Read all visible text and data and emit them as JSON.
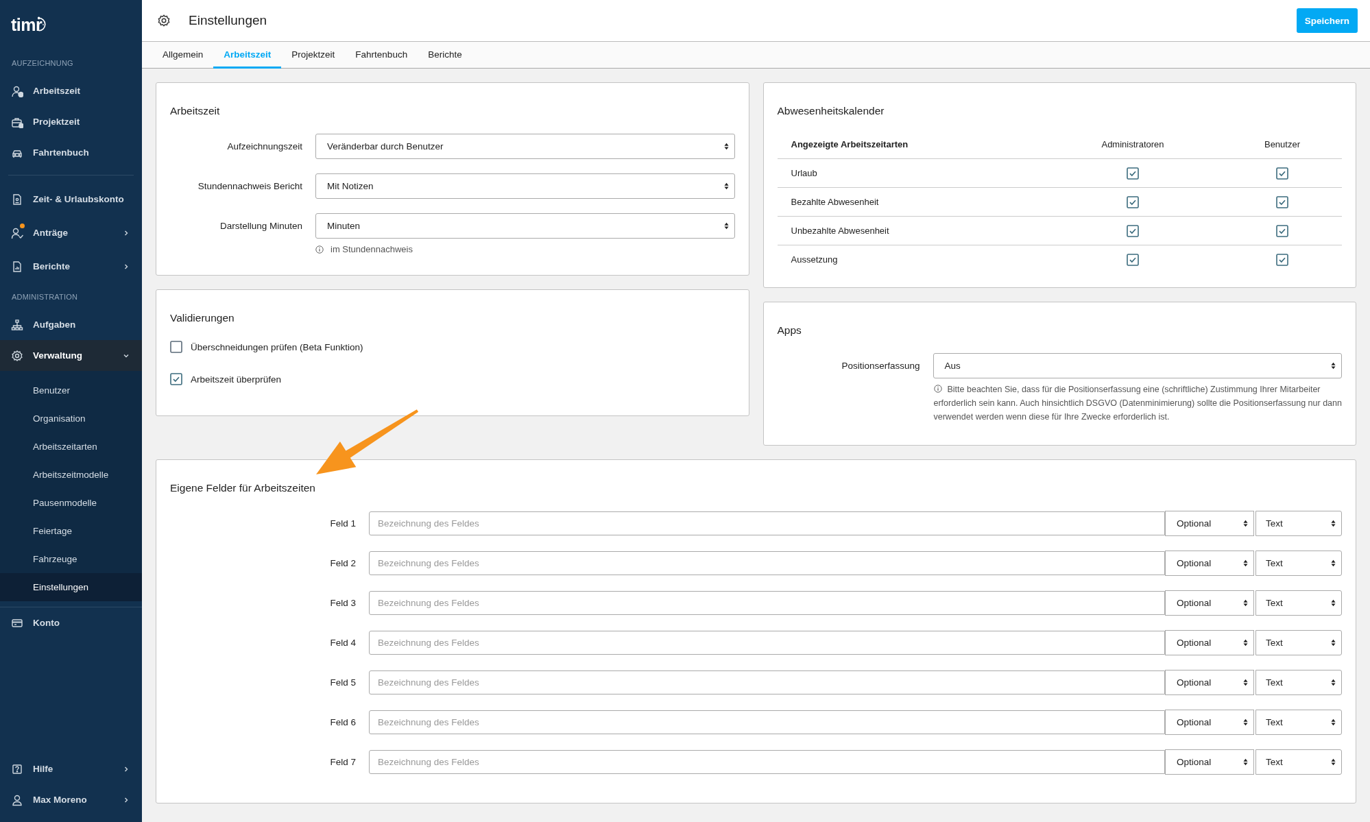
{
  "sidebar": {
    "logo": "timr",
    "sections": [
      {
        "heading": "AUFZEICHNUNG",
        "items": [
          {
            "label": "Arbeitszeit",
            "selected": false,
            "notification": false
          },
          {
            "label": "Projektzeit",
            "selected": false,
            "notification": false
          },
          {
            "label": "Fahrtenbuch",
            "selected": false,
            "notification": false
          }
        ]
      },
      {
        "items": [
          {
            "label": "Zeit- & Urlaubskonto",
            "selected": false,
            "notification": false
          },
          {
            "label": "Anträge",
            "selected": false,
            "notification": true,
            "expanded": false
          },
          {
            "label": "Berichte",
            "selected": false,
            "notification": false,
            "expanded": false
          }
        ]
      },
      {
        "heading": "ADMINISTRATION",
        "items": [
          {
            "label": "Aufgaben",
            "selected": false,
            "notification": false
          },
          {
            "label": "Verwaltung",
            "selected": true,
            "notification": false,
            "expanded": true,
            "children": [
              {
                "label": "Benutzer",
                "selected": false
              },
              {
                "label": "Organisation",
                "selected": false
              },
              {
                "label": "Arbeitszeitarten",
                "selected": false
              },
              {
                "label": "Arbeitszeitmodelle",
                "selected": false
              },
              {
                "label": "Pausenmodelle",
                "selected": false
              },
              {
                "label": "Feiertage",
                "selected": false
              },
              {
                "label": "Fahrzeuge",
                "selected": false
              },
              {
                "label": "Einstellungen",
                "selected": true
              }
            ]
          }
        ]
      },
      {
        "items": [
          {
            "label": "Konto",
            "selected": false,
            "notification": false
          }
        ]
      }
    ],
    "bottom": [
      {
        "label": "Hilfe",
        "selected": false,
        "notification": false,
        "expanded": false
      },
      {
        "label": "Max Moreno",
        "selected": false,
        "notification": false,
        "expanded": false
      }
    ]
  },
  "header": {
    "title": "Einstellungen",
    "save_button": "Speichern"
  },
  "tabs": [
    {
      "label": "Allgemein",
      "selected": false
    },
    {
      "label": "Arbeitszeit",
      "selected": true
    },
    {
      "label": "Projektzeit",
      "selected": false
    },
    {
      "label": "Fahrtenbuch",
      "selected": false
    },
    {
      "label": "Berichte",
      "selected": false
    }
  ],
  "arbeitszeit": {
    "title": "Arbeitszeit",
    "fields": [
      {
        "label": "Aufzeichnungszeit",
        "value": "Veränderbar durch Benutzer"
      },
      {
        "label": "Stundennachweis Bericht",
        "value": "Mit Notizen"
      },
      {
        "label": "Darstellung Minuten",
        "value": "Minuten"
      }
    ],
    "hint": "im Stundennachweis"
  },
  "validierungen": {
    "title": "Validierungen",
    "checks": [
      {
        "label": "Überschneidungen prüfen (Beta Funktion)",
        "checked": false
      },
      {
        "label": "Arbeitszeit überprüfen",
        "checked": true
      }
    ]
  },
  "abwesenheitskalender": {
    "title": "Abwesenheitskalender",
    "columns": [
      "Angezeigte Arbeitszeitarten",
      "Administratoren",
      "Benutzer"
    ],
    "rows": [
      {
        "label": "Urlaub",
        "administratoren": true,
        "benutzer": true
      },
      {
        "label": "Bezahlte Abwesenheit",
        "administratoren": true,
        "benutzer": true
      },
      {
        "label": "Unbezahlte Abwesenheit",
        "administratoren": true,
        "benutzer": true
      },
      {
        "label": "Aussetzung",
        "administratoren": true,
        "benutzer": true
      }
    ]
  },
  "apps": {
    "title": "Apps",
    "fields": [
      {
        "label": "Positionserfassung",
        "value": "Aus"
      }
    ],
    "hint": "Bitte beachten Sie, dass für die Positionserfassung eine (schriftliche) Zustimmung Ihrer Mitarbeiter erforderlich sein kann. Auch hinsichtlich DSGVO (Datenminimierung) sollte die Positionserfassung nur dann verwendet werden wenn diese für Ihre Zwecke erforderlich ist."
  },
  "eigene_felder": {
    "title": "Eigene Felder für Arbeitszeiten",
    "rows": [
      {
        "label": "Feld 1",
        "placeholder": "Bezeichnung des Feldes",
        "requirement": "Optional",
        "type": "Text"
      },
      {
        "label": "Feld 2",
        "placeholder": "Bezeichnung des Feldes",
        "requirement": "Optional",
        "type": "Text"
      },
      {
        "label": "Feld 3",
        "placeholder": "Bezeichnung des Feldes",
        "requirement": "Optional",
        "type": "Text"
      },
      {
        "label": "Feld 4",
        "placeholder": "Bezeichnung des Feldes",
        "requirement": "Optional",
        "type": "Text"
      },
      {
        "label": "Feld 5",
        "placeholder": "Bezeichnung des Feldes",
        "requirement": "Optional",
        "type": "Text"
      },
      {
        "label": "Feld 6",
        "placeholder": "Bezeichnung des Feldes",
        "requirement": "Optional",
        "type": "Text"
      },
      {
        "label": "Feld 7",
        "placeholder": "Bezeichnung des Feldes",
        "requirement": "Optional",
        "type": "Text"
      }
    ]
  }
}
